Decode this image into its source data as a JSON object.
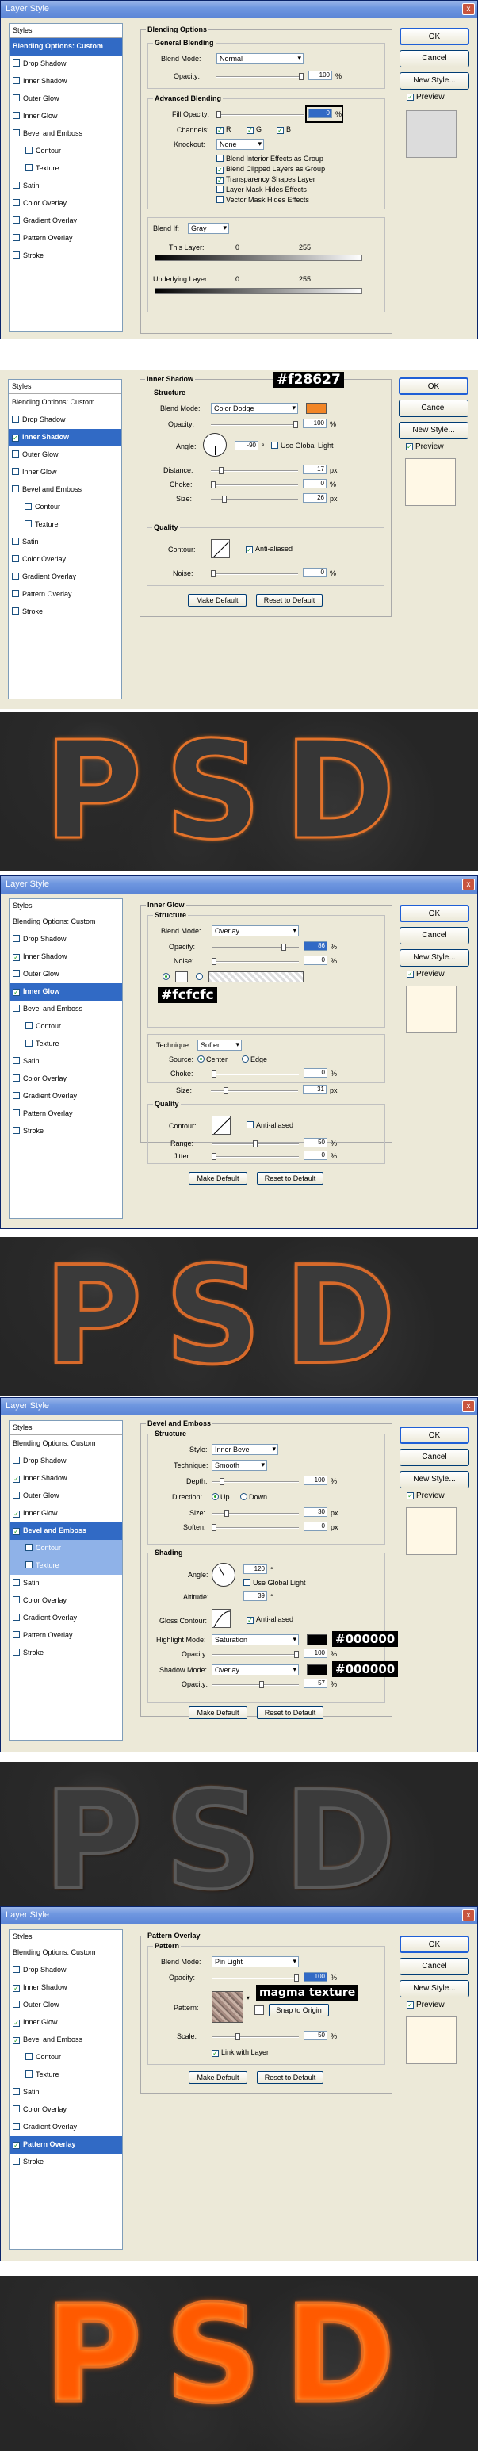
{
  "common": {
    "window_title": "Layer Style",
    "close_glyph": "x",
    "styles_header": "Styles",
    "buttons": {
      "ok": "OK",
      "cancel": "Cancel",
      "new_style": "New Style...",
      "preview": "Preview"
    },
    "list": [
      "Blending Options: Custom",
      "Drop Shadow",
      "Inner Shadow",
      "Outer Glow",
      "Inner Glow",
      "Bevel and Emboss",
      "Contour",
      "Texture",
      "Satin",
      "Color Overlay",
      "Gradient Overlay",
      "Pattern Overlay",
      "Stroke"
    ],
    "make_default": "Make Default",
    "reset_default": "Reset to Default"
  },
  "d1": {
    "panel_title": "Blending Options",
    "general": "General Blending",
    "blend_mode_label": "Blend Mode:",
    "blend_mode": "Normal",
    "opacity_label": "Opacity:",
    "opacity": "100",
    "pct": "%",
    "advanced": "Advanced Blending",
    "fill_label": "Fill Opacity:",
    "fill": "0",
    "channels_label": "Channels:",
    "channels": [
      "R",
      "G",
      "B"
    ],
    "knockout_label": "Knockout:",
    "knockout": "None",
    "checks": [
      "Blend Interior Effects as Group",
      "Blend Clipped Layers as Group",
      "Transparency Shapes Layer",
      "Layer Mask Hides Effects",
      "Vector Mask Hides Effects"
    ],
    "blendif_label": "Blend If:",
    "blendif": "Gray",
    "this_layer": "This Layer:",
    "underlying": "Underlying Layer:",
    "v0": "0",
    "v255": "255"
  },
  "d2": {
    "panel_title": "Inner Shadow",
    "structure": "Structure",
    "blend_mode_label": "Blend Mode:",
    "blend_mode": "Color Dodge",
    "color": "#f28627",
    "callout": "#f28627",
    "opacity_label": "Opacity:",
    "opacity": "100",
    "angle_label": "Angle:",
    "angle": "-90",
    "deg": "°",
    "global_light": "Use Global Light",
    "distance_label": "Distance:",
    "distance": "17",
    "choke_label": "Choke:",
    "choke": "0",
    "size_label": "Size:",
    "size": "26",
    "px": "px",
    "pct": "%",
    "quality": "Quality",
    "contour_label": "Contour:",
    "anti_aliased": "Anti-aliased",
    "noise_label": "Noise:",
    "noise": "0"
  },
  "d3": {
    "panel_title": "Inner Glow",
    "structure": "Structure",
    "blend_mode_label": "Blend Mode:",
    "blend_mode": "Overlay",
    "opacity_label": "Opacity:",
    "opacity": "86",
    "noise_label": "Noise:",
    "noise": "0",
    "callout": "#fcfcfc",
    "elements": "Elements",
    "technique_label": "Technique:",
    "technique": "Softer",
    "source_label": "Source:",
    "center": "Center",
    "edge": "Edge",
    "choke_label": "Choke:",
    "choke": "0",
    "size_label": "Size:",
    "size": "31",
    "px": "px",
    "pct": "%",
    "quality": "Quality",
    "contour_label": "Contour:",
    "anti_aliased": "Anti-aliased",
    "range_label": "Range:",
    "range": "50",
    "jitter_label": "Jitter:",
    "jitter": "0"
  },
  "d4": {
    "panel_title": "Bevel and Emboss",
    "structure": "Structure",
    "style_label": "Style:",
    "style": "Inner Bevel",
    "technique_label": "Technique:",
    "technique": "Smooth",
    "depth_label": "Depth:",
    "depth": "100",
    "direction_label": "Direction:",
    "up": "Up",
    "down": "Down",
    "size_label": "Size:",
    "size": "30",
    "soften_label": "Soften:",
    "soften": "0",
    "px": "px",
    "pct": "%",
    "shading": "Shading",
    "angle_label": "Angle:",
    "angle": "120",
    "deg": "°",
    "global_light": "Use Global Light",
    "altitude_label": "Altitude:",
    "altitude": "39",
    "gloss_label": "Gloss Contour:",
    "anti_aliased": "Anti-aliased",
    "highlight_label": "Highlight Mode:",
    "highlight": "Saturation",
    "opacity_label": "Opacity:",
    "hl_opacity": "100",
    "shadow_label": "Shadow Mode:",
    "shadow": "Overlay",
    "sh_opacity": "57",
    "callout_hl": "#000000",
    "callout_sh": "#000000"
  },
  "d5": {
    "panel_title": "Pattern Overlay",
    "pattern_group": "Pattern",
    "blend_mode_label": "Blend Mode:",
    "blend_mode": "Pin Light",
    "opacity_label": "Opacity:",
    "opacity": "100",
    "pattern_label": "Pattern:",
    "callout": "magma texture",
    "snap": "Snap to Origin",
    "scale_label": "Scale:",
    "scale": "50",
    "pct": "%",
    "link": "Link with Layer"
  },
  "result": {
    "text": "PSD"
  },
  "colors": {
    "orange": "#f28627",
    "xp_blue": "#316ac5",
    "panel_bg": "#ece9d8"
  }
}
